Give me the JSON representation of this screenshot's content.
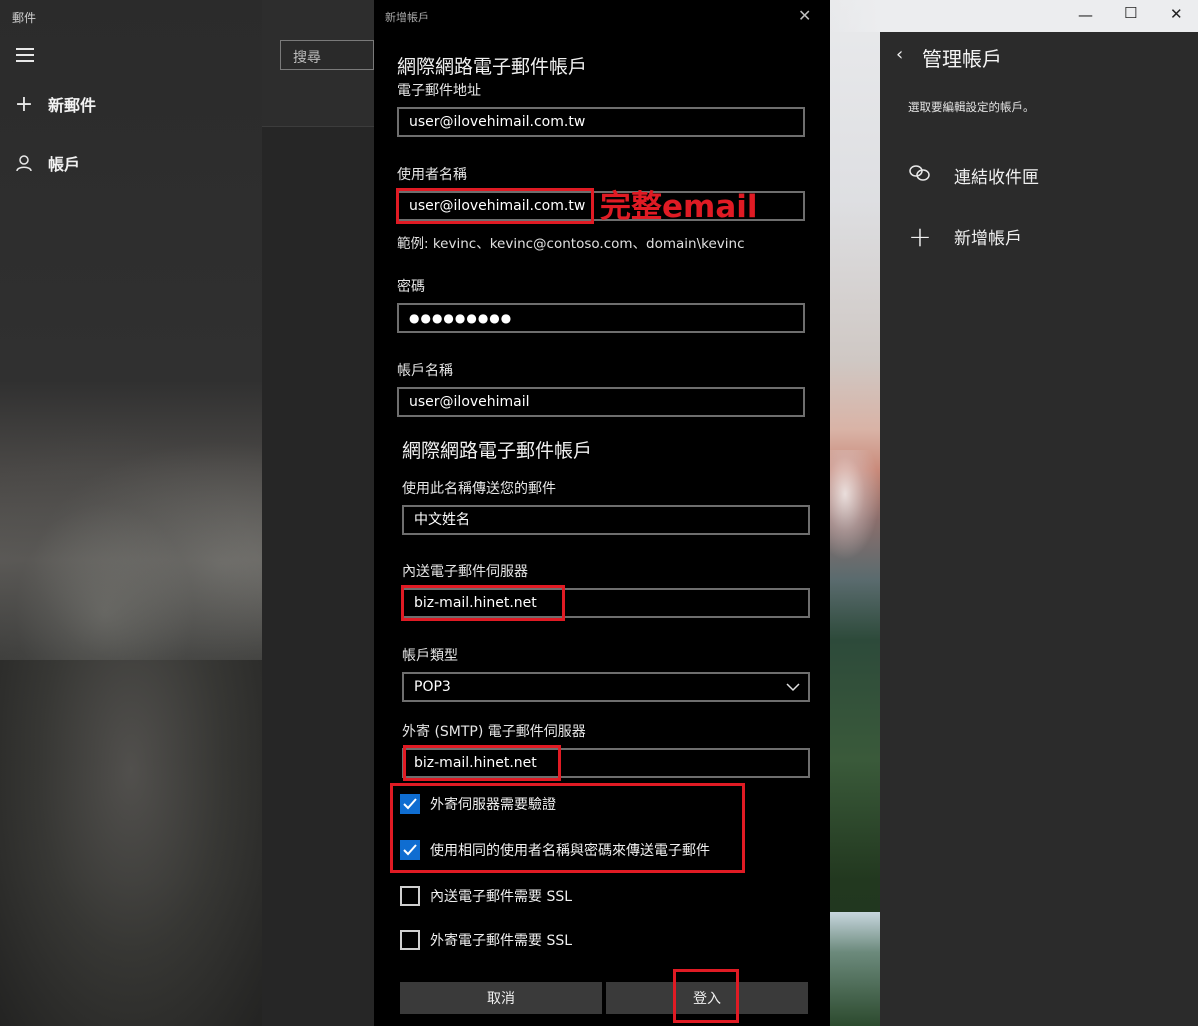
{
  "mail_app": {
    "title": "郵件",
    "new_mail": "新郵件",
    "accounts": "帳戶",
    "search_placeholder": "搜尋"
  },
  "dialog": {
    "title": "新增帳戶",
    "heading": "網際網路電子郵件帳戶",
    "email_label": "電子郵件地址",
    "email_value": "user@ilovehimail.com.tw",
    "username_label": "使用者名稱",
    "username_value": "user@ilovehimail.com.tw",
    "username_annotation": "完整email",
    "username_hint": "範例: kevinc、kevinc@contoso.com、domain\\kevinc",
    "password_label": "密碼",
    "password_value": "●●●●●●●●●",
    "account_name_label": "帳戶名稱",
    "account_name_value": "user@ilovehimail",
    "section_heading": "網際網路電子郵件帳戶",
    "send_name_label": "使用此名稱傳送您的郵件",
    "send_name_value": "中文姓名",
    "incoming_label": "內送電子郵件伺服器",
    "incoming_value": "biz-mail.hinet.net",
    "account_type_label": "帳戶類型",
    "account_type_value": "POP3",
    "outgoing_label": "外寄 (SMTP) 電子郵件伺服器",
    "outgoing_value": "biz-mail.hinet.net",
    "checkboxes": [
      {
        "label": "外寄伺服器需要驗證",
        "checked": true
      },
      {
        "label": "使用相同的使用者名稱與密碼來傳送電子郵件",
        "checked": true
      },
      {
        "label": "內送電子郵件需要 SSL",
        "checked": false
      },
      {
        "label": "外寄電子郵件需要 SSL",
        "checked": false
      }
    ],
    "cancel_label": "取消",
    "signin_label": "登入"
  },
  "manage": {
    "title": "管理帳戶",
    "subtitle": "選取要編輯設定的帳戶。",
    "link_inbox": "連結收件匣",
    "add_account": "新增帳戶"
  },
  "colors": {
    "accent": "#0f6dd1",
    "annotation_red": "#e01b24"
  }
}
